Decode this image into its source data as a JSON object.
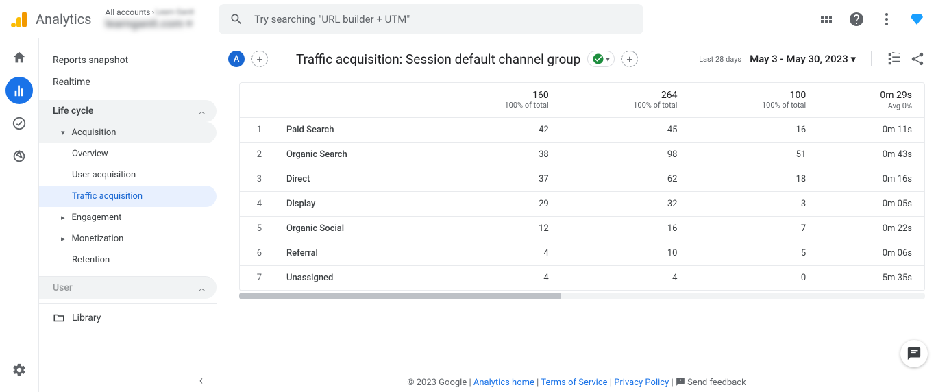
{
  "header": {
    "product": "Analytics",
    "account_top": "All accounts",
    "account_sub": "learnganit.com",
    "search_placeholder": "Try searching \"URL builder + UTM\""
  },
  "sidenav": {
    "snapshot": "Reports snapshot",
    "realtime": "Realtime",
    "lifecycle": "Life cycle",
    "acquisition": "Acquisition",
    "overview": "Overview",
    "user_acq": "User acquisition",
    "traffic_acq": "Traffic acquisition",
    "engagement": "Engagement",
    "monetization": "Monetization",
    "retention": "Retention",
    "user": "User",
    "library": "Library"
  },
  "report": {
    "title": "Traffic acquisition: Session default channel group",
    "period_label": "Last 28 days",
    "date_range": "May 3 - May 30, 2023"
  },
  "summary": {
    "c1": {
      "val": "160",
      "sub": "100% of total"
    },
    "c2": {
      "val": "264",
      "sub": "100% of total"
    },
    "c3": {
      "val": "100",
      "sub": "100% of total"
    },
    "c4": {
      "val": "0m 29s",
      "sub": "Avg 0%"
    }
  },
  "rows": [
    {
      "n": "1",
      "name": "Paid Search",
      "c1": "42",
      "c2": "45",
      "c3": "16",
      "c4": "0m 11s"
    },
    {
      "n": "2",
      "name": "Organic Search",
      "c1": "38",
      "c2": "98",
      "c3": "51",
      "c4": "0m 43s"
    },
    {
      "n": "3",
      "name": "Direct",
      "c1": "37",
      "c2": "62",
      "c3": "18",
      "c4": "0m 16s"
    },
    {
      "n": "4",
      "name": "Display",
      "c1": "29",
      "c2": "32",
      "c3": "3",
      "c4": "0m 05s"
    },
    {
      "n": "5",
      "name": "Organic Social",
      "c1": "12",
      "c2": "16",
      "c3": "7",
      "c4": "0m 22s"
    },
    {
      "n": "6",
      "name": "Referral",
      "c1": "4",
      "c2": "10",
      "c3": "5",
      "c4": "0m 06s"
    },
    {
      "n": "7",
      "name": "Unassigned",
      "c1": "4",
      "c2": "4",
      "c3": "0",
      "c4": "5m 35s"
    }
  ],
  "footer": {
    "copyright": "© 2023 Google",
    "home": "Analytics home",
    "tos": "Terms of Service",
    "privacy": "Privacy Policy",
    "feedback": "Send feedback"
  }
}
